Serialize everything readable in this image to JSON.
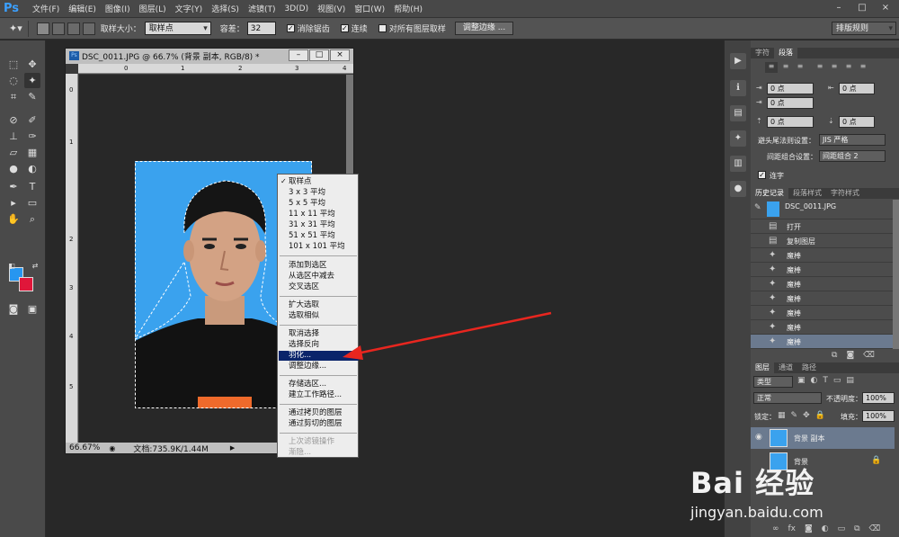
{
  "app": {
    "logo": "Ps"
  },
  "menubar": [
    "文件(F)",
    "编辑(E)",
    "图像(I)",
    "图层(L)",
    "文字(Y)",
    "选择(S)",
    "滤镜(T)",
    "3D(D)",
    "视图(V)",
    "窗口(W)",
    "帮助(H)"
  ],
  "window_controls": {
    "minimize": "–",
    "maximize": "□",
    "close": "×"
  },
  "options_bar": {
    "sample_size_label": "取样大小：",
    "sample_size_value": "取样点",
    "tolerance_label": "容差：",
    "tolerance_value": "32",
    "antialias_label": "消除锯齿",
    "contiguous_label": "连续",
    "all_layers_label": "对所有图层取样",
    "refine_edge_button": "调整边缘 ...",
    "workspace_value": "排版规则"
  },
  "document": {
    "title": "DSC_0011.JPG @ 66.7% (背景 副本, RGB/8) *",
    "zoom": "66.67%",
    "doc_info": "文档:735.9K/1.44M",
    "ruler_h": [
      "0",
      "1",
      "2",
      "3",
      "4"
    ],
    "ruler_v": [
      "0",
      "1",
      "2",
      "3",
      "4",
      "5"
    ]
  },
  "context_menu": {
    "groups": [
      [
        "取样点",
        "3 x 3 平均",
        "5 x 5 平均",
        "11 x 11 平均",
        "31 x 31 平均",
        "51 x 51 平均",
        "101 x 101 平均"
      ],
      [
        "添加到选区",
        "从选区中减去",
        "交叉选区"
      ],
      [
        "扩大选取",
        "选取相似"
      ],
      [
        "取消选择",
        "选择反向",
        "羽化...",
        "调整边缘..."
      ],
      [
        "存储选区...",
        "建立工作路径..."
      ],
      [
        "通过拷贝的图层",
        "通过剪切的图层"
      ],
      [
        "上次滤镜操作",
        "渐隐..."
      ]
    ],
    "checked": "取样点",
    "highlighted": "羽化...",
    "disabled": [
      "上次滤镜操作",
      "渐隐..."
    ]
  },
  "character_panel": {
    "tabs": [
      "字符",
      "段落"
    ],
    "indent_left": "0 点",
    "indent_right": "0 点",
    "indent_first": "0 点",
    "space_before": "0 点",
    "space_after": "0 点",
    "kinsoku_label": "避头尾法则设置：",
    "kinsoku_value": "JIS 严格",
    "mojikumi_label": "间距组合设置：",
    "mojikumi_value": "间距组合 2",
    "hyphenate_label": "连字"
  },
  "history_panel": {
    "tabs": [
      "历史记录",
      "段落样式",
      "字符样式"
    ],
    "snapshot": "DSC_0011.JPG",
    "items": [
      "打开",
      "复制图层",
      "魔棒",
      "魔棒",
      "魔棒",
      "魔棒",
      "魔棒",
      "魔棒",
      "魔棒"
    ]
  },
  "layers_panel": {
    "tabs": [
      "图层",
      "通道",
      "路径"
    ],
    "filter_value": "类型",
    "blend_mode": "正常",
    "opacity_label": "不透明度：",
    "opacity_value": "100%",
    "lock_label": "锁定：",
    "fill_label": "填充：",
    "fill_value": "100%",
    "layers": [
      "背景 副本",
      "背景"
    ]
  },
  "watermark": {
    "main": "Bai 经验",
    "url": "jingyan.baidu.com"
  },
  "colors": {
    "foreground": "#2796f0",
    "background": "#e0163a",
    "photo_bg": "#3aa2ee",
    "menu_highlight": "#0a246a"
  }
}
